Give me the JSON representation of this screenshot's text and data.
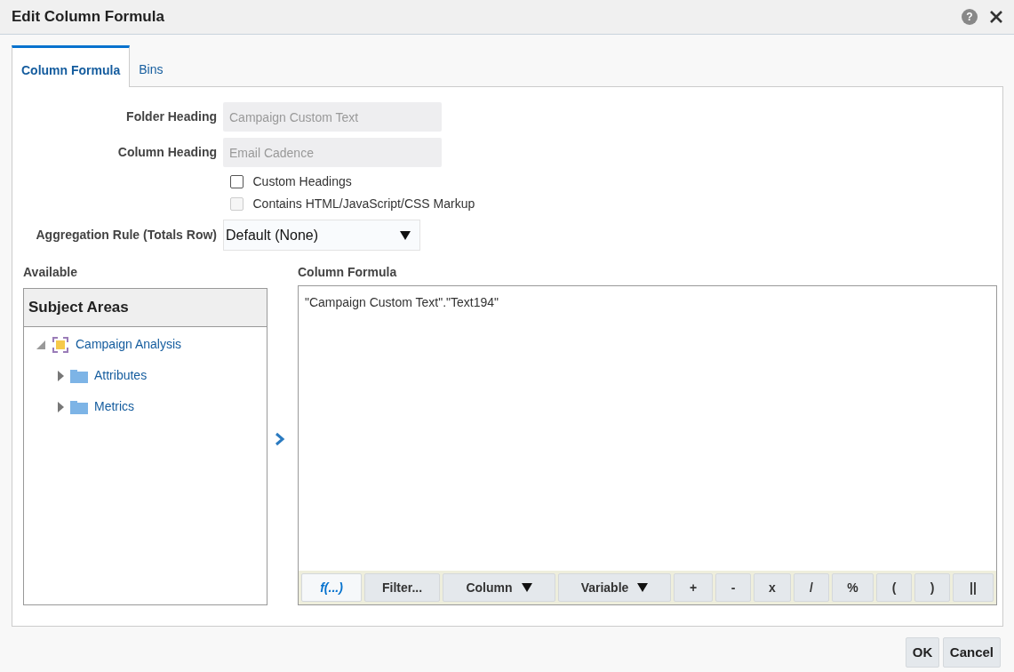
{
  "window": {
    "title": "Edit Column Formula",
    "help_icon": "?"
  },
  "tabs": [
    {
      "label": "Column Formula",
      "selected": true
    },
    {
      "label": "Bins",
      "selected": false
    }
  ],
  "form": {
    "folder_heading": {
      "label": "Folder Heading",
      "value": "Campaign Custom Text",
      "disabled": true
    },
    "column_heading": {
      "label": "Column Heading",
      "value": "Email Cadence",
      "disabled": true
    },
    "checkboxes": [
      {
        "label": "Custom Headings",
        "checked": false,
        "disabled": false
      },
      {
        "label": "Contains HTML/JavaScript/CSS Markup",
        "checked": false,
        "disabled": true
      }
    ],
    "aggregation_rule": {
      "label": "Aggregation Rule (Totals Row)",
      "value": "Default (None)"
    }
  },
  "available": {
    "label": "Available",
    "header": "Subject Areas",
    "tree": [
      {
        "label": "Campaign Analysis",
        "kind": "subject-area",
        "expanded": true,
        "children": [
          {
            "label": "Attributes",
            "kind": "folder",
            "expanded": false
          },
          {
            "label": "Metrics",
            "kind": "folder",
            "expanded": false
          }
        ]
      }
    ]
  },
  "formula": {
    "label": "Column Formula",
    "value": "\"Campaign Custom Text\".\"Text194\"",
    "toolbar": [
      {
        "label": "f(...)",
        "kind": "function"
      },
      {
        "label": "Filter...",
        "kind": "plain"
      },
      {
        "label": "Column",
        "kind": "dropdown"
      },
      {
        "label": "Variable",
        "kind": "dropdown"
      },
      {
        "label": "+",
        "kind": "plain"
      },
      {
        "label": "-",
        "kind": "plain"
      },
      {
        "label": "x",
        "kind": "plain"
      },
      {
        "label": "/",
        "kind": "plain"
      },
      {
        "label": "%",
        "kind": "plain"
      },
      {
        "label": "(",
        "kind": "plain"
      },
      {
        "label": ")",
        "kind": "plain"
      },
      {
        "label": "||",
        "kind": "plain"
      }
    ]
  },
  "buttons": [
    "OK",
    "Cancel"
  ]
}
